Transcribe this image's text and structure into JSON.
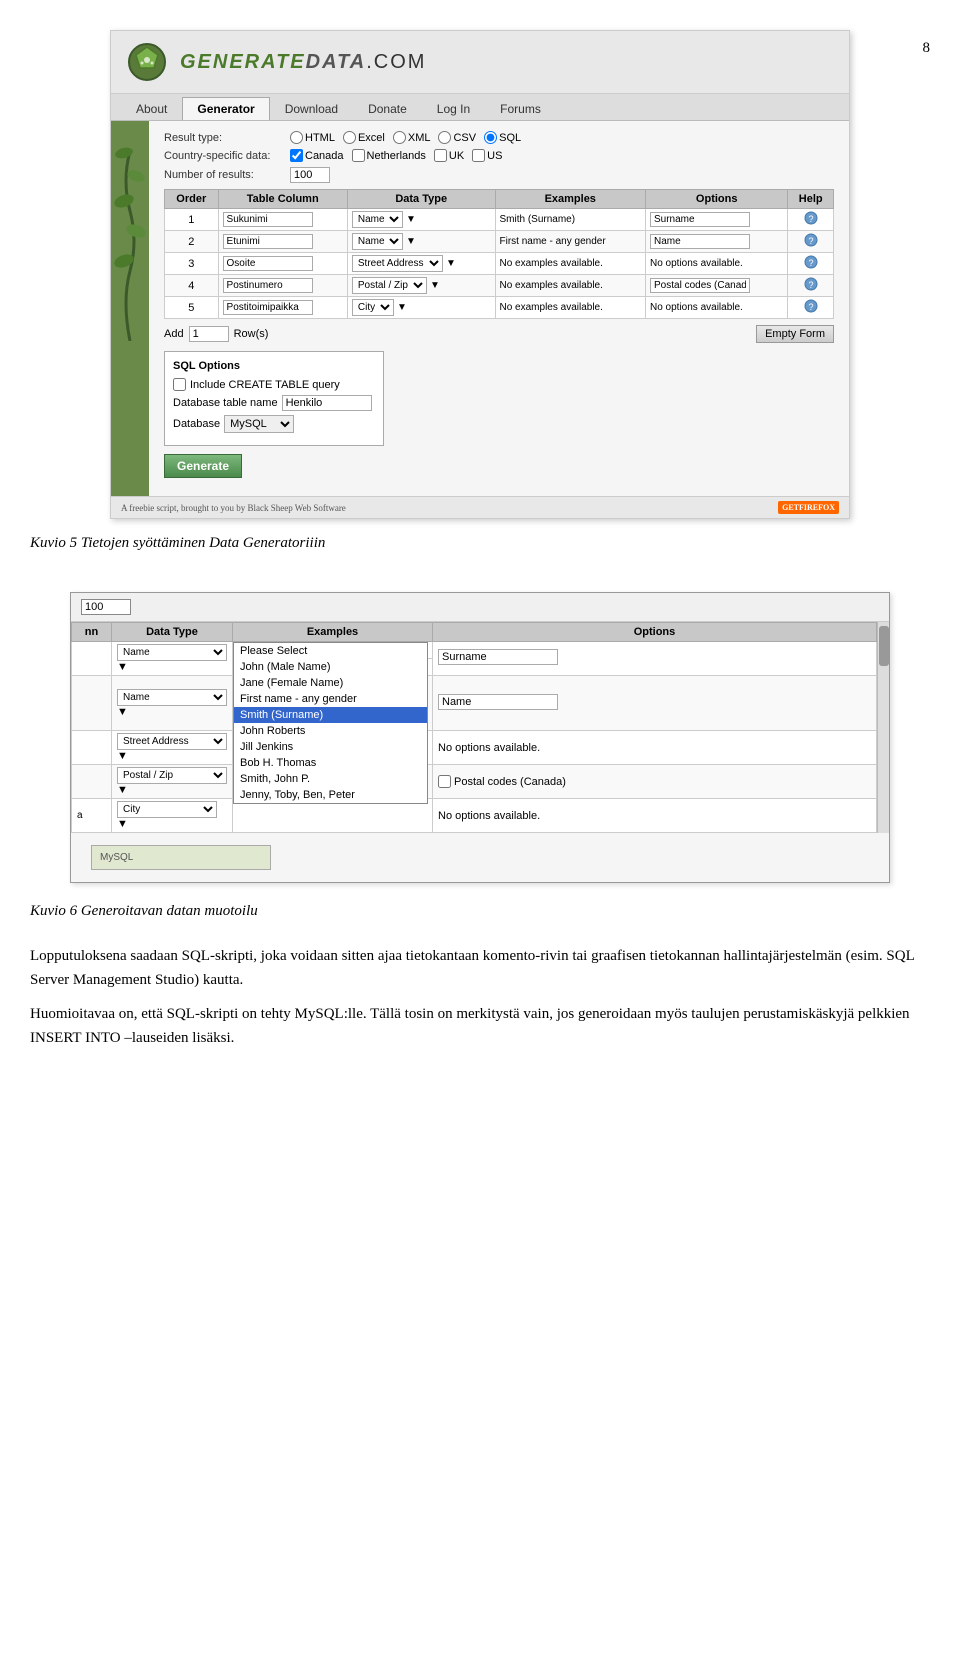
{
  "page": {
    "number": "8"
  },
  "screenshot1": {
    "logo_text": "GenerateData.Com",
    "nav_items": [
      "About",
      "Generator",
      "Download",
      "Donate",
      "Log In",
      "Forums"
    ],
    "active_nav": "Generator",
    "result_type_label": "Result type:",
    "result_types": [
      "HTML",
      "Excel",
      "XML",
      "CSV",
      "SQL"
    ],
    "selected_result": "SQL",
    "country_label": "Country-specific data:",
    "countries": [
      "Canada",
      "Netherlands",
      "UK",
      "US"
    ],
    "checked_countries": [
      "Canada"
    ],
    "num_results_label": "Number of results:",
    "num_results_value": "100",
    "table_headers": [
      "Order",
      "Table Column",
      "Data Type",
      "Examples",
      "Options",
      "Help"
    ],
    "table_rows": [
      {
        "order": "1",
        "column": "Sukunimi",
        "type": "Name",
        "example": "Smith (Surname)",
        "option": "Surname"
      },
      {
        "order": "2",
        "column": "Etunimi",
        "type": "Name",
        "example": "First name - any gender",
        "option": "Name"
      },
      {
        "order": "3",
        "column": "Osoite",
        "type": "Street Address",
        "example": "No examples available.",
        "option": "No options available."
      },
      {
        "order": "4",
        "column": "Postinumero",
        "type": "Postal / Zip",
        "example": "No examples available.",
        "option": "Postal codes (Canada)"
      },
      {
        "order": "5",
        "column": "Postitoimipaikka",
        "type": "City",
        "example": "No examples available.",
        "option": "No options available."
      }
    ],
    "add_label": "Add",
    "add_value": "1",
    "rows_label": "Row(s)",
    "empty_form_btn": "Empty Form",
    "sql_options_title": "SQL Options",
    "sql_include_label": "Include CREATE TABLE query",
    "db_table_label": "Database table name",
    "db_table_value": "Henkilo",
    "db_label": "Database",
    "db_value": "MySQL",
    "generate_btn": "Generate",
    "footer_text": "A freebie script, brought to you by Black Sheep Web Software",
    "footer_logo": "GETFIREFOX"
  },
  "screenshot2": {
    "number_value": "100",
    "table_headers": [
      "nn",
      "Data Type",
      "Examples",
      "Options"
    ],
    "table_rows": [
      {
        "col": "Name",
        "example": "Smith (Surname)",
        "option": "Surname"
      },
      {
        "col": "Name",
        "example": "",
        "option": "Name"
      },
      {
        "col": "Street Address",
        "example": "",
        "option": "No options available."
      },
      {
        "col": "Postal / Zip",
        "example": "",
        "option": "Postal codes (Canada)"
      },
      {
        "col": "City",
        "example": "",
        "option": "No options available."
      }
    ],
    "dropdown_items": [
      {
        "label": "Please Select",
        "highlighted": false
      },
      {
        "label": "John (Male Name)",
        "highlighted": false
      },
      {
        "label": "Jane (Female Name)",
        "highlighted": false
      },
      {
        "label": "First name - any gender",
        "highlighted": false
      },
      {
        "label": "Smith (Surname)",
        "highlighted": true
      },
      {
        "label": "John Roberts",
        "highlighted": false
      },
      {
        "label": "Jill Jenkins",
        "highlighted": false
      },
      {
        "label": "Bob H. Thomas",
        "highlighted": false
      },
      {
        "label": "Smith, John P.",
        "highlighted": false
      },
      {
        "label": "Jenny, Toby, Ben, Peter",
        "highlighted": false
      }
    ],
    "sql_box_placeholder": "MySQL"
  },
  "caption1": "Kuvio 5 Tietojen syöttäminen Data Generatoriiin",
  "caption2": "Kuvio 6 Generoitavan datan muotoilu",
  "body_paragraphs": [
    "Lopputuloksena saadaan SQL-skripti, joka voidaan sitten ajaa tietokantaan komento-rivin tai graafisen tietokannan hallintajärjestelmän (esim. SQL Server Management Studio) kautta.",
    "Huomioitavaa on, että SQL-skripti on tehty MySQL:lle. Tällä tosin on merkitystä vain, jos generoidaan myös taulujen perustamiskäskyjä pelkkien INSERT INTO –lauseiden lisäksi."
  ]
}
